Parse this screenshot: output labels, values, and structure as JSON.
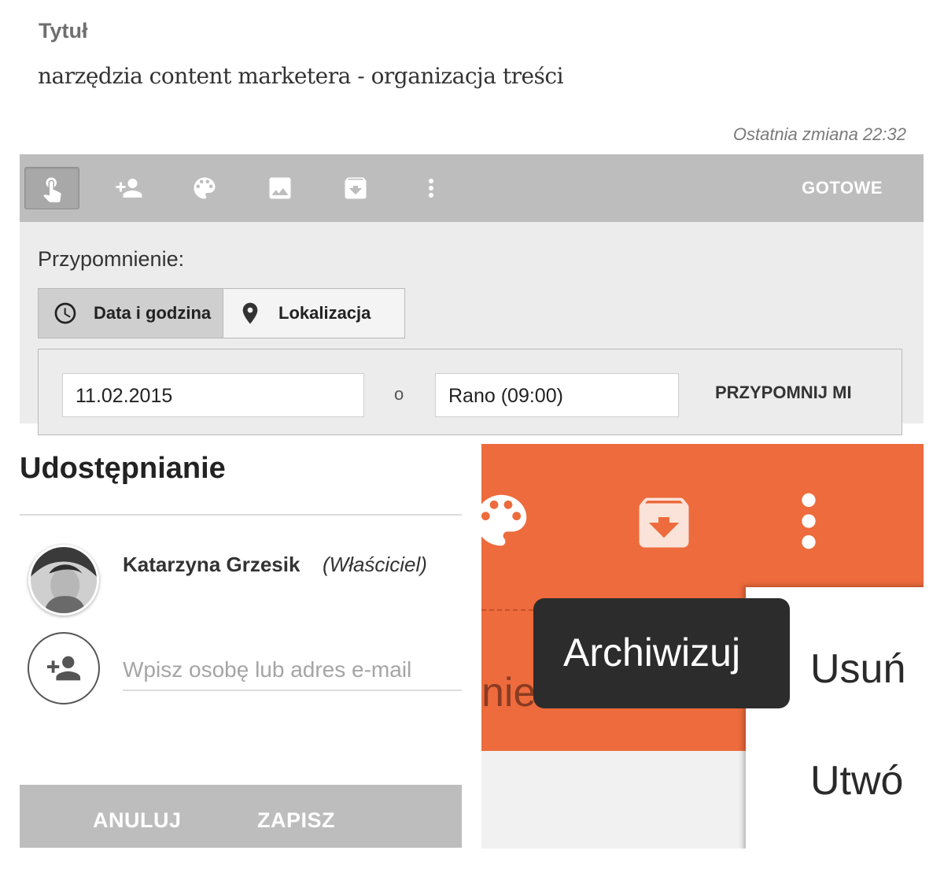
{
  "note": {
    "title_label": "Tytuł",
    "title_value": "narzędzia content marketera - organizacja treści",
    "last_change": "Ostatnia zmiana 22:32",
    "toolbar": {
      "icons": [
        "touch-gesture-icon",
        "add-person-icon",
        "palette-icon",
        "image-icon",
        "archive-icon",
        "more-vertical-icon"
      ],
      "done_label": "GOTOWE"
    },
    "reminder": {
      "label": "Przypomnienie:",
      "tab_datetime": "Data i godzina",
      "tab_location": "Lokalizacja",
      "date_value": "11.02.2015",
      "at_separator": "o",
      "time_value": "Rano (09:00)",
      "remind_button": "PRZYPOMNIJ MI"
    }
  },
  "sharing": {
    "title": "Udostępnianie",
    "owner_name": "Katarzyna Grzesik",
    "owner_role": "(Właściciel)",
    "input_placeholder": "Wpisz osobę lub adres e-mail",
    "cancel_label": "ANULUJ",
    "save_label": "ZAPISZ"
  },
  "zoom": {
    "text_fragment": "nie",
    "tooltip": "Archiwizuj",
    "menu_delete": "Usuń",
    "menu_create": "Utwó",
    "accent_color": "#ed6b3c"
  }
}
